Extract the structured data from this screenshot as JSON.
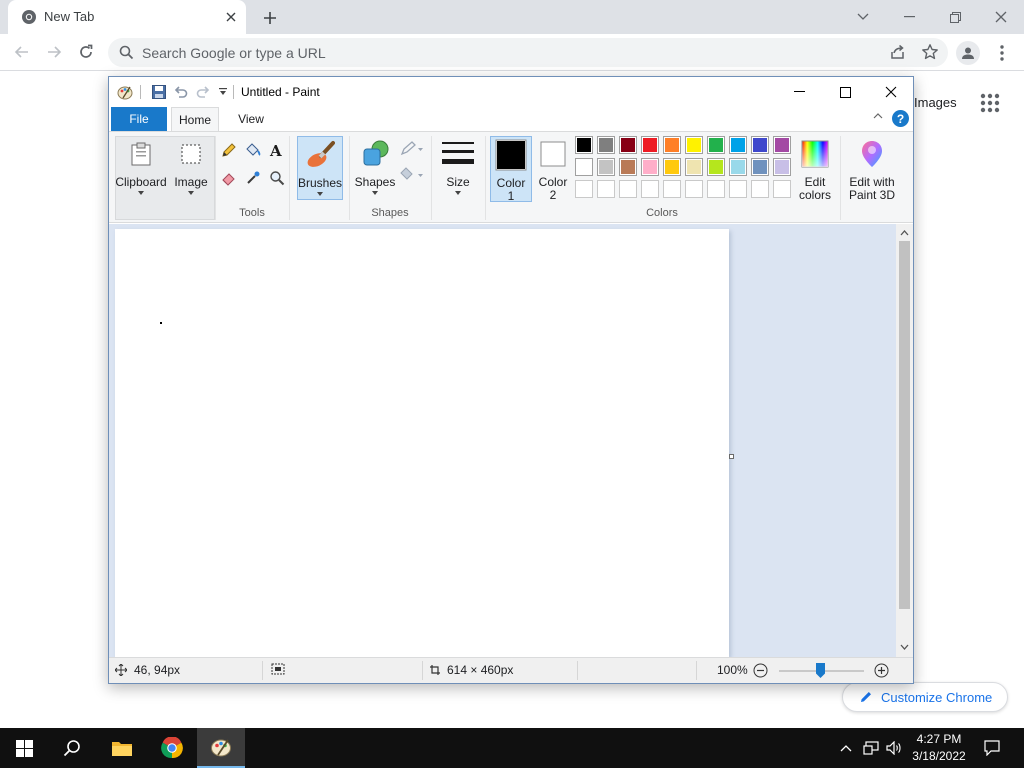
{
  "browser": {
    "tab_title": "New Tab",
    "omnibox_placeholder": "Search Google or type a URL",
    "ntp_images_link": "Images",
    "customize_label": "Customize Chrome"
  },
  "paint": {
    "window_title": "Untitled - Paint",
    "ribbon_tabs": [
      "File",
      "Home",
      "View"
    ],
    "help_glyph": "?",
    "groups": {
      "clipboard": "Clipboard",
      "image": "Image",
      "tools": "Tools",
      "brushes": "Brushes",
      "shapes_button": "Shapes",
      "shapes_group": "Shapes",
      "size": "Size",
      "colors_group": "Colors"
    },
    "color1": {
      "line1": "Color",
      "line2": "1",
      "value": "#000000"
    },
    "color2": {
      "line1": "Color",
      "line2": "2",
      "value": "#ffffff"
    },
    "edit_colors": {
      "line1": "Edit",
      "line2": "colors"
    },
    "edit_3d": {
      "line1": "Edit with",
      "line2": "Paint 3D"
    },
    "palette_row1": [
      "#000000",
      "#7f7f7f",
      "#880015",
      "#ed1c24",
      "#ff7f27",
      "#fff200",
      "#22b14c",
      "#00a2e8",
      "#3f48cc",
      "#a349a4"
    ],
    "palette_row2": [
      "#ffffff",
      "#c3c3c3",
      "#b97a57",
      "#ffaec9",
      "#ffc90e",
      "#efe4b0",
      "#b5e61d",
      "#99d9ea",
      "#7092be",
      "#c8bfe7"
    ],
    "palette_row3": [
      "",
      "",
      "",
      "",
      "",
      "",
      "",
      "",
      "",
      ""
    ],
    "status": {
      "cursor_pos": "46, 94px",
      "canvas_size": "614 × 460px",
      "zoom": "100%"
    }
  },
  "taskbar": {
    "time": "4:27 PM",
    "date": "3/18/2022"
  }
}
